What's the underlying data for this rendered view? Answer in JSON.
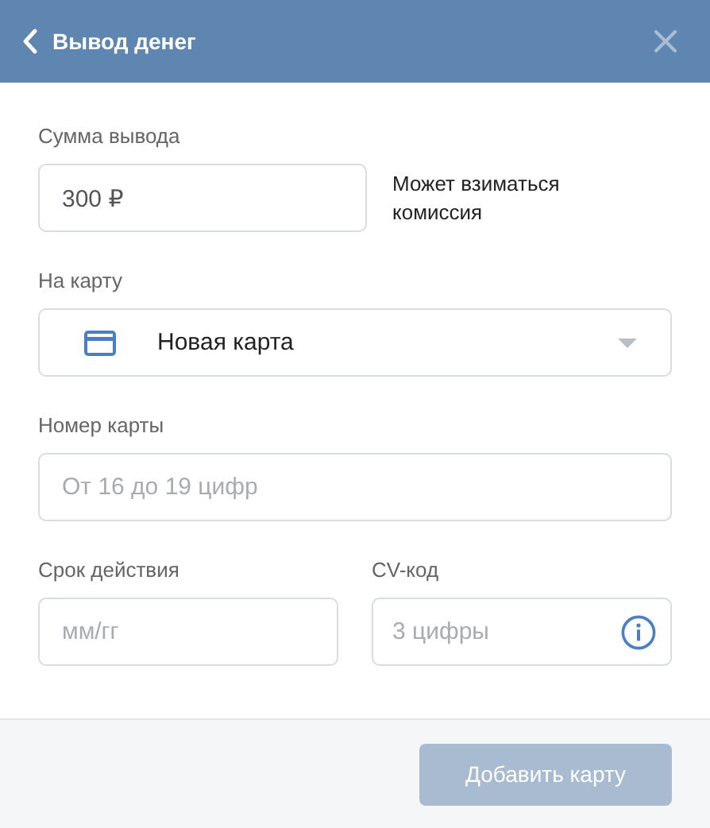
{
  "header": {
    "title": "Вывод денег"
  },
  "amount": {
    "label": "Сумма вывода",
    "value": "300 ₽",
    "note": "Может взиматься комиссия"
  },
  "card_select": {
    "label": "На карту",
    "value": "Новая карта"
  },
  "card_number": {
    "label": "Номер карты",
    "placeholder": "От 16 до 19 цифр"
  },
  "expiry": {
    "label": "Срок действия",
    "placeholder": "мм/гг"
  },
  "cvv": {
    "label": "CV-код",
    "placeholder": "3 цифры"
  },
  "submit": {
    "label": "Добавить карту",
    "disabled": true
  }
}
